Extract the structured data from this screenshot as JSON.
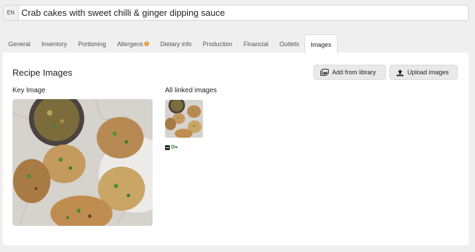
{
  "header": {
    "language": "EN",
    "recipe_name": "Crab cakes with sweet chilli & ginger dipping sauce"
  },
  "tabs": [
    {
      "label": "General",
      "active": false
    },
    {
      "label": "Inventory",
      "active": false
    },
    {
      "label": "Portioning",
      "active": false
    },
    {
      "label": "Allergens",
      "active": false,
      "warning": true
    },
    {
      "label": "Dietary info",
      "active": false
    },
    {
      "label": "Production",
      "active": false
    },
    {
      "label": "Financial",
      "active": false
    },
    {
      "label": "Outlets",
      "active": false
    },
    {
      "label": "Images",
      "active": true
    }
  ],
  "panel": {
    "title": "Recipe Images",
    "add_from_library_label": "Add from library",
    "upload_images_label": "Upload images",
    "key_image_label": "Key Image",
    "all_linked_label": "All linked images"
  },
  "colors": {
    "warning": "#e39a2c",
    "key_image_accent": "#3e8c3a"
  },
  "icons": {
    "warning": "warning-icon",
    "library": "image-library-icon",
    "upload": "upload-icon",
    "key_image_marker": "key-image-marker-icon",
    "key": "key-icon"
  }
}
